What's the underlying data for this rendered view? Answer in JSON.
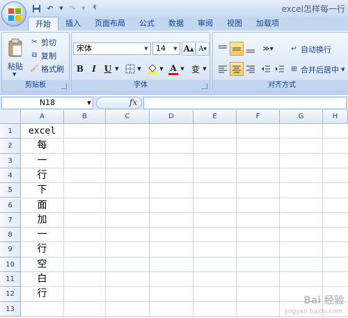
{
  "window": {
    "title": "excel怎样每一行"
  },
  "quick_access": {
    "save_icon": "save-icon",
    "undo_icon": "undo-icon",
    "redo_icon": "redo-icon"
  },
  "tabs": [
    {
      "label": "开始",
      "active": true
    },
    {
      "label": "插入"
    },
    {
      "label": "页面布局"
    },
    {
      "label": "公式"
    },
    {
      "label": "数据"
    },
    {
      "label": "审阅"
    },
    {
      "label": "视图"
    },
    {
      "label": "加载项"
    }
  ],
  "clipboard": {
    "group_label": "剪贴板",
    "paste": "粘贴",
    "cut": "剪切",
    "copy": "复制",
    "format_painter": "格式刷"
  },
  "font": {
    "group_label": "字体",
    "name": "宋体",
    "size": "14",
    "bold": "B",
    "italic": "I",
    "underline": "U",
    "grow": "A",
    "shrink": "A",
    "font_color": "A",
    "phonetic": "变"
  },
  "alignment": {
    "group_label": "对齐方式",
    "wrap_text": "自动换行",
    "merge_center": "合并后居中"
  },
  "formula_bar": {
    "name_box": "N18",
    "fx": "fx",
    "value": ""
  },
  "columns": [
    "A",
    "B",
    "C",
    "D",
    "E",
    "F",
    "G",
    "H"
  ],
  "rows": [
    "1",
    "2",
    "3",
    "4",
    "5",
    "6",
    "7",
    "8",
    "9",
    "10",
    "11",
    "12",
    "13"
  ],
  "cells_a": [
    "excel",
    "每",
    "一",
    "行",
    "下",
    "面",
    "加",
    "一",
    "行",
    "空",
    "白",
    "行",
    ""
  ],
  "watermark": {
    "text": "Bai 经验",
    "url": "jingyan.baidu.com"
  }
}
